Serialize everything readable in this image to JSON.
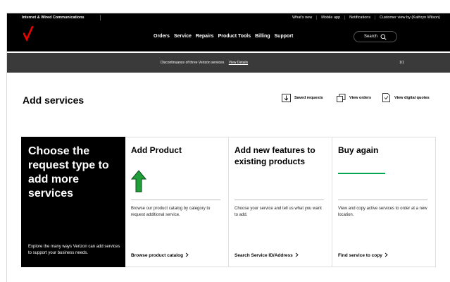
{
  "topbar": {
    "section": "Internet & Wired Communications",
    "links": [
      "What's new",
      "Mobile app",
      "Notifications",
      "Customer view by (Kathryn Wilson)"
    ]
  },
  "nav": {
    "items": [
      "Orders",
      "Service",
      "Repairs",
      "Product Tools",
      "Billing",
      "Support"
    ],
    "search_label": "Search"
  },
  "banner": {
    "text": "Discontinuance of three Verizon services",
    "link": "View Details",
    "pager": "1/1"
  },
  "page": {
    "title": "Add services",
    "actions": [
      "Saved requests",
      "View orders",
      "View digital quotes"
    ]
  },
  "intro": {
    "heading": "Choose the request type to add more services",
    "footer": "Explore the many ways Verizon can add services to support your business needs."
  },
  "cards": [
    {
      "heading": "Add Product",
      "description": "Browse our product catalog by category to request additional service.",
      "link": "Browse product catalog"
    },
    {
      "heading": "Add new features to existing products",
      "description": "Choose your service and tell us what you want to add.",
      "link": "Search Service ID/Address"
    },
    {
      "heading": "Buy again",
      "description": "View and copy active services to order at a new location.",
      "link": "Find service to copy"
    }
  ],
  "colors": {
    "brand_red": "#ee0000",
    "green": "#00a650",
    "black": "#000000",
    "banner_gray": "#3a3a3a"
  },
  "icons": {
    "logo": "verizon-check-logo",
    "search": "search-icon",
    "saved": "download-icon",
    "orders": "copy-icon",
    "quotes": "document-icon",
    "add_product": "green-up-arrow-icon"
  }
}
